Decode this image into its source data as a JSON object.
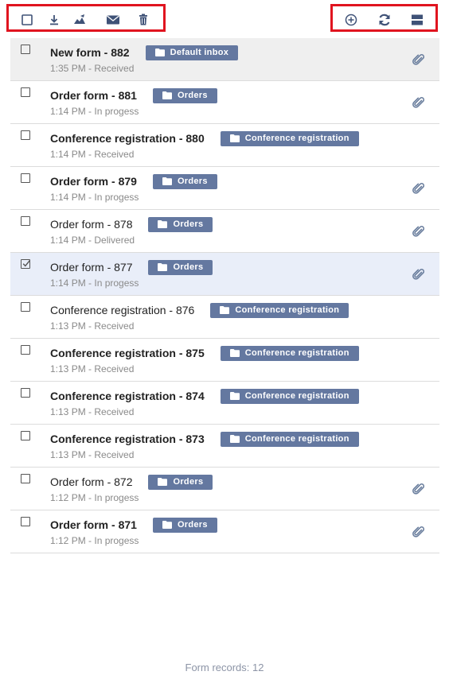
{
  "toolbar": {
    "left_icons": [
      "select-all-checkbox-icon",
      "download-icon",
      "sign-icon",
      "mail-icon",
      "trash-icon"
    ],
    "right_icons": [
      "add-circle-icon",
      "refresh-icon",
      "layout-toggle-icon"
    ],
    "highlight_color": "#e0141f"
  },
  "badge_color": "#6478a0",
  "rows": [
    {
      "title": "New form - 882",
      "subtitle": "1:35 PM - Received",
      "folder": "Default inbox",
      "attachment": true,
      "unread": true,
      "checked": false
    },
    {
      "title": "Order form - 881",
      "subtitle": "1:14 PM - In progess",
      "folder": "Orders",
      "attachment": true,
      "unread": true,
      "checked": false
    },
    {
      "title": "Conference registration - 880",
      "subtitle": "1:14 PM - Received",
      "folder": "Conference registration",
      "attachment": false,
      "unread": true,
      "checked": false
    },
    {
      "title": "Order form - 879",
      "subtitle": "1:14 PM - In progess",
      "folder": "Orders",
      "attachment": true,
      "unread": true,
      "checked": false
    },
    {
      "title": "Order form - 878",
      "subtitle": "1:14 PM - Delivered",
      "folder": "Orders",
      "attachment": true,
      "unread": false,
      "checked": false
    },
    {
      "title": "Order form - 877",
      "subtitle": "1:14 PM - In progess",
      "folder": "Orders",
      "attachment": true,
      "unread": false,
      "checked": true
    },
    {
      "title": "Conference registration - 876",
      "subtitle": "1:13 PM - Received",
      "folder": "Conference registration",
      "attachment": false,
      "unread": false,
      "checked": false
    },
    {
      "title": "Conference registration - 875",
      "subtitle": "1:13 PM - Received",
      "folder": "Conference registration",
      "attachment": false,
      "unread": true,
      "checked": false
    },
    {
      "title": "Conference registration - 874",
      "subtitle": "1:13 PM - Received",
      "folder": "Conference registration",
      "attachment": false,
      "unread": true,
      "checked": false
    },
    {
      "title": "Conference registration - 873",
      "subtitle": "1:13 PM - Received",
      "folder": "Conference registration",
      "attachment": false,
      "unread": true,
      "checked": false
    },
    {
      "title": "Order form - 872",
      "subtitle": "1:12 PM - In progess",
      "folder": "Orders",
      "attachment": true,
      "unread": false,
      "checked": false
    },
    {
      "title": "Order form - 871",
      "subtitle": "1:12 PM - In progess",
      "folder": "Orders",
      "attachment": true,
      "unread": true,
      "checked": false
    }
  ],
  "footer": {
    "text": "Form records: 12"
  }
}
